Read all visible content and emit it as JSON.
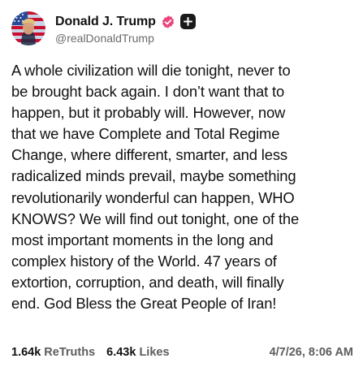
{
  "author": {
    "display_name": "Donald J. Trump",
    "handle": "@realDonaldTrump",
    "verified_color": "#e8467c"
  },
  "post": {
    "text": "A whole civilization will die tonight, never to\nbe brought back again. I don’t want that to\nhappen, but it probably will. However, now\nthat we have Complete and Total Regime\nChange, where different, smarter, and less\nradicalized minds prevail, maybe something\nrevolutionarily wonderful can happen, WHO\nKNOWS? We will find out tonight, one of the\nmost important moments in the long and\ncomplex history of the World. 47 years of\nextortion, corruption, and death, will finally\nend. God Bless the Great People of Iran!"
  },
  "stats": {
    "retruths_count": "1.64k",
    "retruths_label": "ReTruths",
    "likes_count": "6.43k",
    "likes_label": "Likes",
    "timestamp": "4/7/26, 8:06 AM"
  }
}
